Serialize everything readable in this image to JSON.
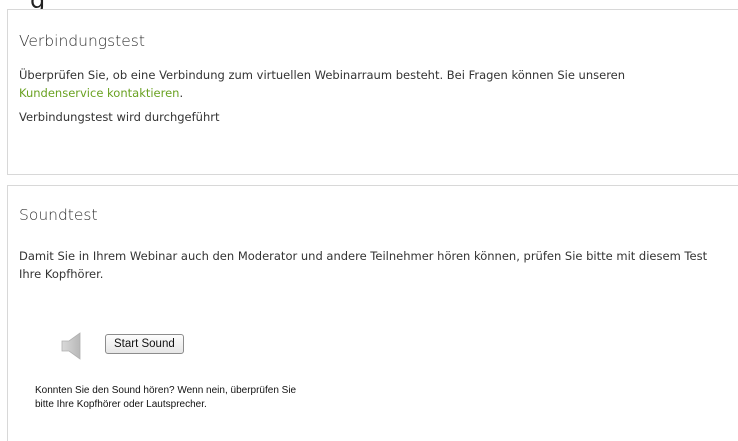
{
  "header_fragment": "g",
  "connection": {
    "title": "Verbindungstest",
    "description_prefix": "Überprüfen Sie, ob eine Verbindung zum virtuellen Webinarraum besteht. Bei Fragen können Sie unseren",
    "link_text": "Kundenservice kontaktieren",
    "description_suffix": ".",
    "status": "Verbindungstest wird durchgeführt"
  },
  "sound": {
    "title": "Soundtest",
    "description": "Damit Sie in Ihrem Webinar auch den Moderator und andere Teilnehmer hören können, prüfen Sie bitte mit diesem Test Ihre Kopfhörer.",
    "start_button": "Start Sound",
    "hint_line1": "Konnten Sie den Sound hören? Wenn nein, überprüfen Sie",
    "hint_line2": "bitte Ihre Kopfhörer oder Lautsprecher.",
    "speaker_icon": "speaker-icon"
  },
  "colors": {
    "link": "#6aa222",
    "border": "#d8d8d8",
    "text": "#333333"
  }
}
